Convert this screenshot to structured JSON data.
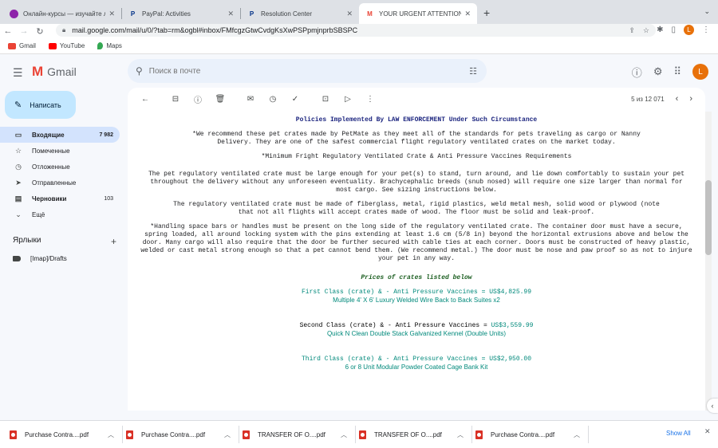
{
  "browser": {
    "tabs": [
      {
        "title": "Онлайн-курсы — изучайте л...",
        "favicon_color": "#8e24aa",
        "active": false
      },
      {
        "title": "PayPal: Activities",
        "favicon_color": "#003087",
        "active": false
      },
      {
        "title": "Resolution Center",
        "favicon_color": "#003087",
        "active": false
      },
      {
        "title": "YOUR URGENT ATTENTION IS...",
        "favicon_color": "#ea4335",
        "active": true
      }
    ],
    "url": "mail.google.com/mail/u/0/?tab=rm&ogbl#inbox/FMfcgzGtwCvdgKsXwPSPpmjnprbSBSPC",
    "profile_initial": "L",
    "bookmarks": [
      {
        "label": "Gmail",
        "color": "#ea4335"
      },
      {
        "label": "YouTube",
        "color": "#ff0000"
      },
      {
        "label": "Maps",
        "color": "#34a853"
      }
    ]
  },
  "gmail": {
    "logo_text": "Gmail",
    "search_placeholder": "Поиск в почте",
    "account_initial": "L",
    "compose_label": "Написать",
    "nav": [
      {
        "label": "Входящие",
        "count": "7 982",
        "icon": "inbox-icon",
        "glyph": "▭",
        "active": true,
        "bold": true
      },
      {
        "label": "Помеченные",
        "count": "",
        "icon": "star-icon",
        "glyph": "☆",
        "active": false,
        "bold": false
      },
      {
        "label": "Отложенные",
        "count": "",
        "icon": "clock-icon",
        "glyph": "◷",
        "active": false,
        "bold": false
      },
      {
        "label": "Отправленные",
        "count": "",
        "icon": "send-icon",
        "glyph": "➤",
        "active": false,
        "bold": false
      },
      {
        "label": "Черновики",
        "count": "103",
        "icon": "draft-icon",
        "glyph": "▤",
        "active": false,
        "bold": true
      },
      {
        "label": "Ещё",
        "count": "",
        "icon": "chevron-down-icon",
        "glyph": "⌄",
        "active": false,
        "bold": false
      }
    ],
    "labels_heading": "Ярлыки",
    "labels": [
      {
        "label": "[Imap]/Drafts"
      }
    ],
    "pager_text": "5 из 12 071"
  },
  "email": {
    "title": "Policies Implemented By LAW ENFORCEMENT  Under Such Circumstance",
    "para1": "*We recommend these pet crates made by PetMate as they meet all of the standards for pets traveling as cargo or Nanny Delivery. They are one of the safest commercial flight regulatory ventilated crates on the market today.",
    "para2": "*Minimum Fright Regulatory Ventilated Crate & Anti Pressure Vaccines Requirements",
    "para3": "The pet regulatory ventilated crate must be large enough for your pet(s) to stand, turn around, and lie down comfortably to sustain your pet throughout the delivery without any unforeseen eventuality. Brachycephalic breeds (snub nosed) will require one size larger than normal for most cargo. See sizing instructions below.",
    "para4": "The regulatory ventilated crate must be made of fiberglass, metal, rigid plastics, weld metal mesh, solid wood or plywood (note that not all flights will accept crates made of wood. The floor must be solid and leak-proof.",
    "para5": "*Handling space bars or handles must be present on the long side of the regulatory ventilated crate. The container door must have a secure, spring loaded, all around locking system with the pins extending at least 1.6 cm (5/8 in) beyond the horizontal extrusions above and below the door. Many cargo  will also require that the door be further secured with cable ties at each corner. Doors must be constructed of heavy plastic, welded or cast metal strong enough so that a pet cannot bend them. (We recommend metal.) The door must be nose and paw proof so as not to injure your pet in any way.",
    "prices_heading": "Prices of crates listed below",
    "prices": [
      {
        "label": "First Class (crate) & - Anti Pressure Vaccines = ",
        "price": "US$4,825.99",
        "desc": "Multiple 4' X 6' Luxury Welded Wire Back to Back Suites x2"
      },
      {
        "label": "Second Class (crate) & - Anti Pressure Vaccines = ",
        "price": "US$3,559.99",
        "desc": "Quick N Clean Double Stack Galvanized Kennel (Double Units)"
      },
      {
        "label": "Third Class (crate) & - Anti Pressure Vaccines = ",
        "price": "US$2,950.00",
        "desc": "6 or 8 Unit Modular Powder Coated Cage Bank Kit"
      }
    ]
  },
  "downloads": {
    "items": [
      {
        "name": "Purchase Contra....pdf"
      },
      {
        "name": "Purchase Contra....pdf"
      },
      {
        "name": "TRANSFER OF O....pdf"
      },
      {
        "name": "TRANSFER OF O....pdf"
      },
      {
        "name": "Purchase Contra....pdf"
      }
    ],
    "show_all": "Show All"
  }
}
